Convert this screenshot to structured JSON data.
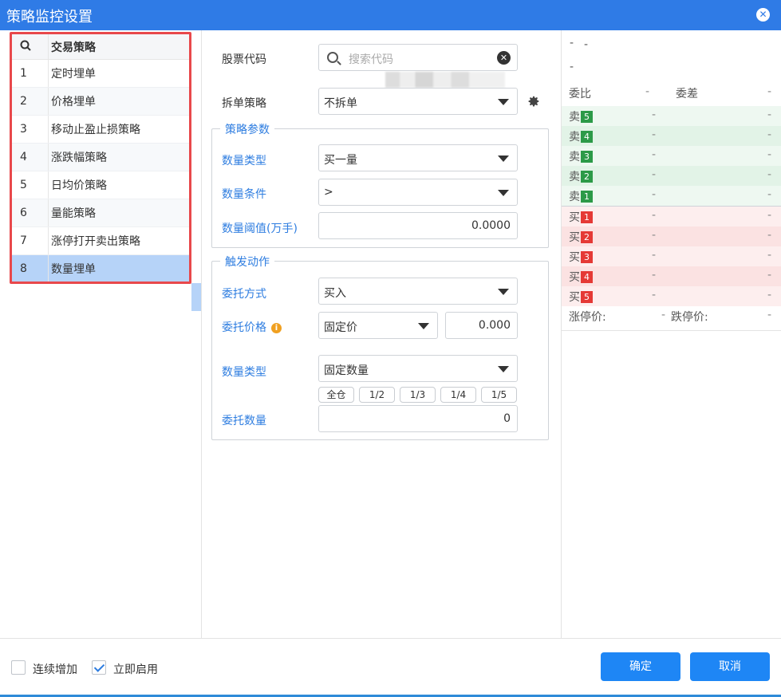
{
  "window": {
    "title": "策略监控设置",
    "close_glyph": "✕"
  },
  "strategy_list": {
    "header": "交易策略",
    "items": [
      {
        "num": "1",
        "name": "定时埋单"
      },
      {
        "num": "2",
        "name": "价格埋单"
      },
      {
        "num": "3",
        "name": "移动止盈止损策略"
      },
      {
        "num": "4",
        "name": "涨跌幅策略"
      },
      {
        "num": "5",
        "name": "日均价策略"
      },
      {
        "num": "6",
        "name": "量能策略"
      },
      {
        "num": "7",
        "name": "涨停打开卖出策略"
      },
      {
        "num": "8",
        "name": "数量埋单"
      }
    ],
    "selected_index": 7
  },
  "form": {
    "stock_code_label": "股票代码",
    "stock_code_placeholder": "搜索代码",
    "split_label": "拆单策略",
    "split_value": "不拆单",
    "params_title": "策略参数",
    "qty_type_label": "数量类型",
    "qty_type_value": "买一量",
    "qty_cond_label": "数量条件",
    "qty_cond_value": ">",
    "qty_threshold_label": "数量阈值(万手)",
    "qty_threshold_value": "0.0000",
    "action_title": "触发动作",
    "order_method_label": "委托方式",
    "order_method_value": "买入",
    "order_price_label": "委托价格",
    "order_price_type": "固定价",
    "order_price_value": "0.000",
    "action_qty_type_label": "数量类型",
    "action_qty_type_value": "固定数量",
    "fractions": [
      "全仓",
      "1/2",
      "1/3",
      "1/4",
      "1/5"
    ],
    "order_qty_label": "委托数量",
    "order_qty_value": "0"
  },
  "orderbook": {
    "top_dash1": "-",
    "top_dash2": "-",
    "top_dash3": "-",
    "ratio_label": "委比",
    "ratio_value": "-",
    "diff_label": "委差",
    "diff_value": "-",
    "sell": [
      {
        "label": "卖",
        "level": "5",
        "price": "-",
        "vol": "-"
      },
      {
        "label": "卖",
        "level": "4",
        "price": "-",
        "vol": "-"
      },
      {
        "label": "卖",
        "level": "3",
        "price": "-",
        "vol": "-"
      },
      {
        "label": "卖",
        "level": "2",
        "price": "-",
        "vol": "-"
      },
      {
        "label": "卖",
        "level": "1",
        "price": "-",
        "vol": "-"
      }
    ],
    "buy": [
      {
        "label": "买",
        "level": "1",
        "price": "-",
        "vol": "-"
      },
      {
        "label": "买",
        "level": "2",
        "price": "-",
        "vol": "-"
      },
      {
        "label": "买",
        "level": "3",
        "price": "-",
        "vol": "-"
      },
      {
        "label": "买",
        "level": "4",
        "price": "-",
        "vol": "-"
      },
      {
        "label": "买",
        "level": "5",
        "price": "-",
        "vol": "-"
      }
    ],
    "limit_up_label": "涨停价:",
    "limit_up_value": "-",
    "limit_down_label": "跌停价:",
    "limit_down_value": "-"
  },
  "footer": {
    "continuous_add_label": "连续增加",
    "continuous_add_checked": false,
    "enable_now_label": "立即启用",
    "enable_now_checked": true,
    "confirm_label": "确定",
    "cancel_label": "取消"
  },
  "colors": {
    "title_bar": "#2f7be6",
    "accent": "#1e86f5",
    "sell_badge": "#2c9a48",
    "buy_badge": "#e53935",
    "highlight_border": "#e8484b"
  }
}
